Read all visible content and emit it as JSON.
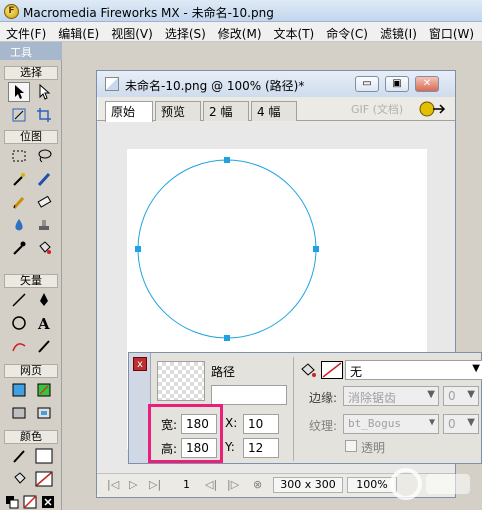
{
  "window": {
    "title": "Macromedia Fireworks MX - 未命名-10.png",
    "app_icon_glyph": "F"
  },
  "menu": [
    "文件(F)",
    "编辑(E)",
    "视图(V)",
    "选择(S)",
    "修改(M)",
    "文本(T)",
    "命令(C)",
    "滤镜(I)",
    "窗口(W)"
  ],
  "tools": {
    "header": "工具",
    "sections": {
      "select": "选择",
      "bitmap": "位图",
      "vector": "矢量",
      "web": "网页",
      "colors": "颜色"
    }
  },
  "document": {
    "title": "未命名-10.png @  100% (路径)*",
    "tabs": [
      "原始",
      "预览",
      "2 幅",
      "4 幅"
    ],
    "active_tab": "原始",
    "format_label": "GIF (文档)",
    "window_buttons": {
      "minimize": "▭",
      "restore": "▣",
      "close": "✕"
    },
    "status": {
      "frame": "1",
      "size": "300 x 300",
      "zoom": "100%"
    }
  },
  "properties": {
    "close_glyph": "x",
    "object_type": "路径",
    "name_value": "",
    "width_label": "宽:",
    "width_value": "180",
    "height_label": "高:",
    "height_value": "180",
    "x_label": "X:",
    "x_value": "10",
    "y_label": "Y:",
    "y_value": "12",
    "fill_value": "无",
    "edge_label": "边缘:",
    "edge_value": "消除锯齿",
    "edge_amount": "0",
    "texture_label": "纹理:",
    "texture_value": "bt_Bogus",
    "texture_amount": "0",
    "transparent_label": "透明"
  },
  "colors": {
    "accent_path": "#1fa3e0",
    "highlight": "#e8207a",
    "title_bg": "#cfdcec"
  }
}
